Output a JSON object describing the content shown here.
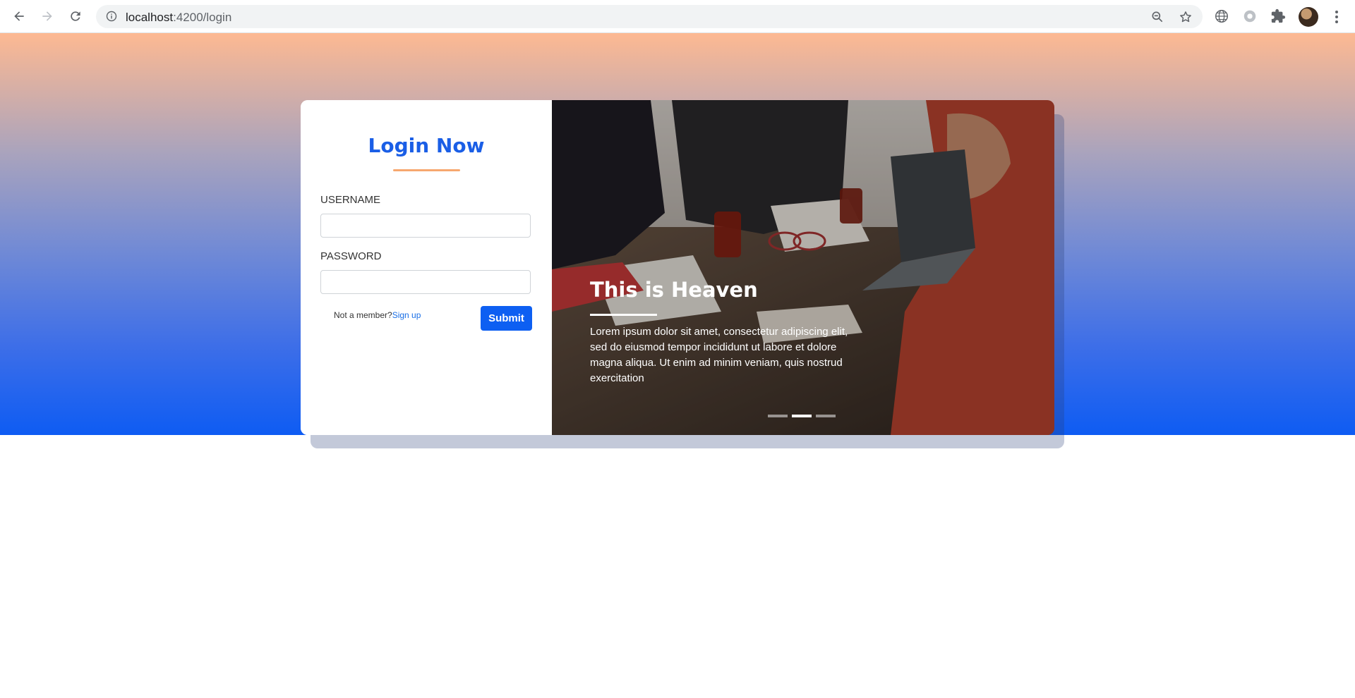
{
  "browser": {
    "url_host": "localhost",
    "url_path": ":4200/login"
  },
  "login": {
    "title": "Login Now",
    "username_label": "USERNAME",
    "password_label": "PASSWORD",
    "member_prompt": "Not a member?",
    "signup_label": "Sign up",
    "submit_label": "Submit"
  },
  "carousel": {
    "caption_title": "This is Heaven",
    "caption_text": "Lorem ipsum dolor sit amet, consectetur adipiscing elit, sed do eiusmod tempor incididunt ut labore et dolore magna aliqua. Ut enim ad minim veniam, quis nostrud exercitation",
    "slide_count": 3,
    "active_slide": 2
  },
  "colors": {
    "brand_blue": "#0d5ff2",
    "accent_orange": "#f7a86f"
  }
}
